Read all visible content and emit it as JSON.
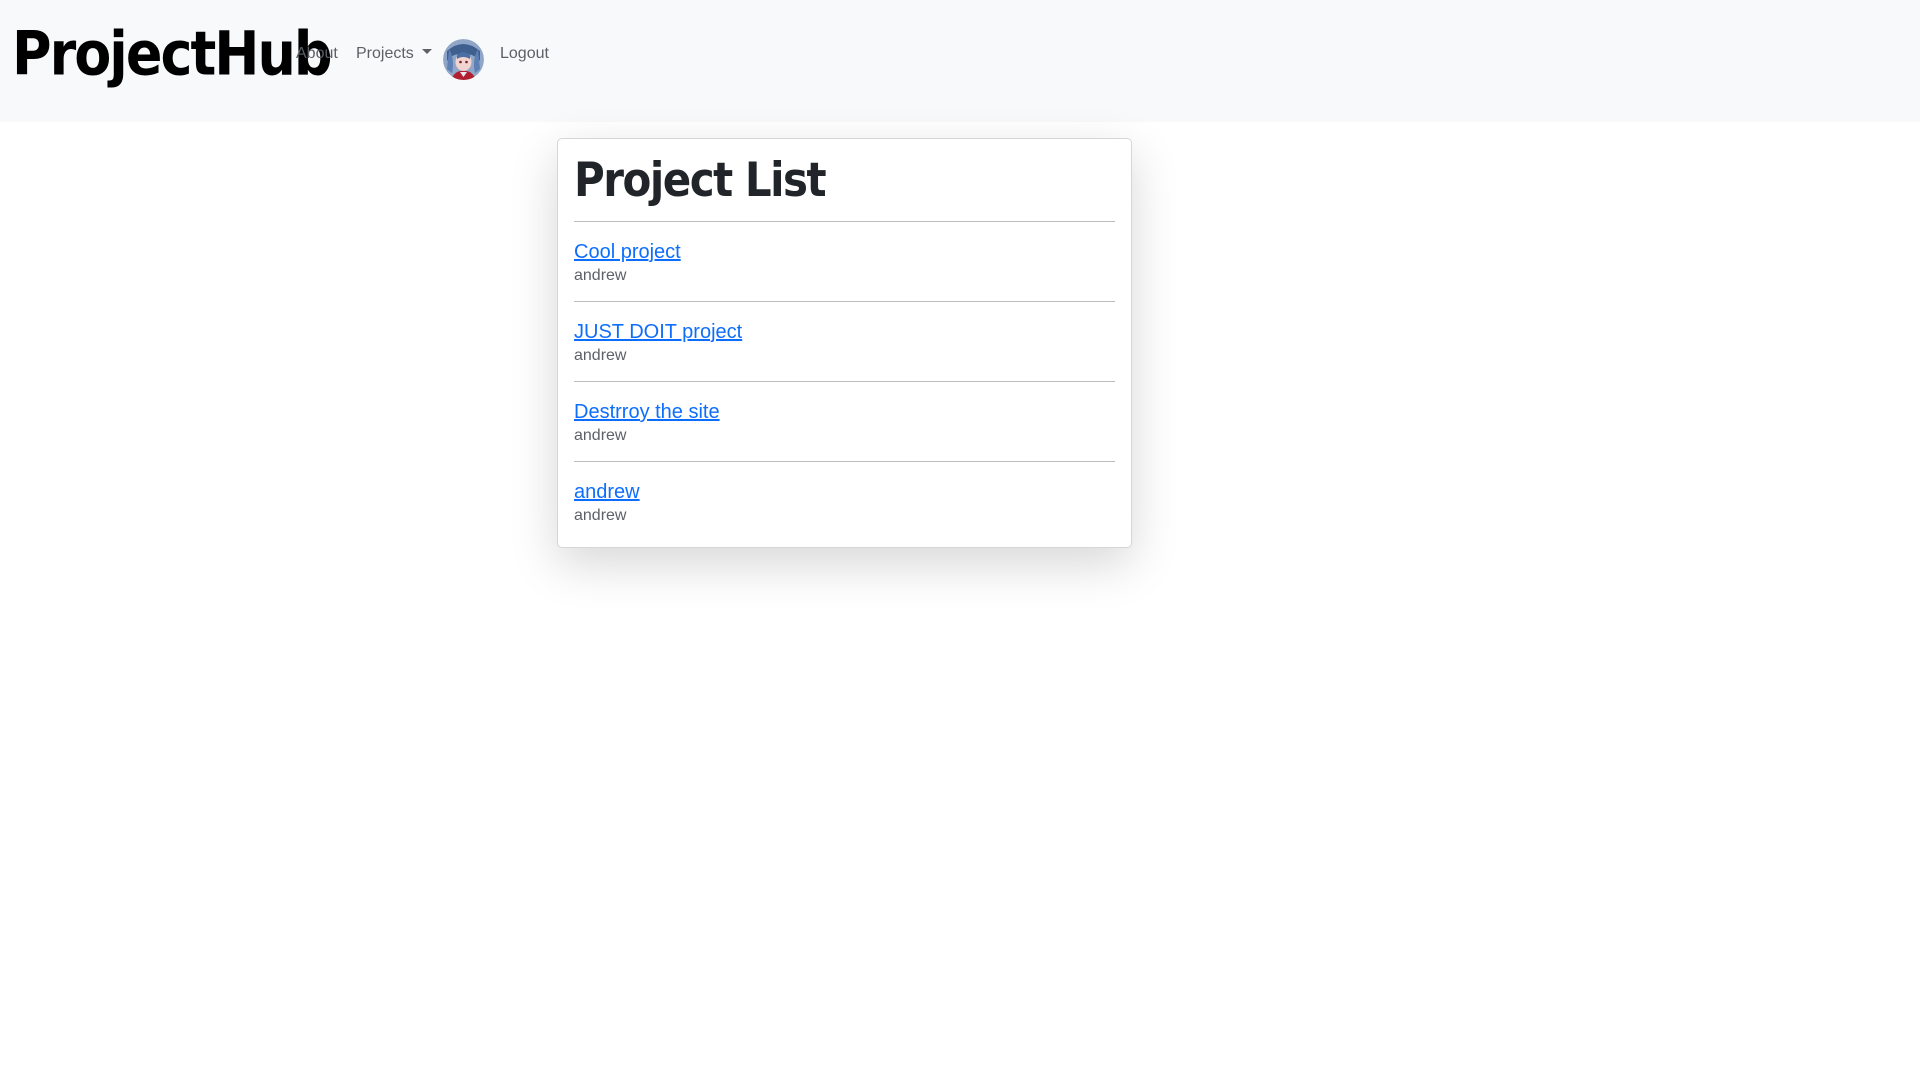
{
  "navbar": {
    "brand": "ProjectHub",
    "about_label": "About",
    "projects_label": "Projects",
    "logout_label": "Logout",
    "icons": {
      "avatar": "user-avatar",
      "projects_dropdown": "caret-down-icon"
    }
  },
  "main": {
    "title": "Project List",
    "projects": [
      {
        "name": "Cool project",
        "owner": "andrew"
      },
      {
        "name": "JUST DOIT project",
        "owner": "andrew"
      },
      {
        "name": "Destrroy the site",
        "owner": "andrew"
      },
      {
        "name": "andrew",
        "owner": "andrew"
      }
    ]
  },
  "colors": {
    "navbar_bg": "#f8f9fa",
    "link": "#0d6efd",
    "muted_text": "#5c6166"
  }
}
